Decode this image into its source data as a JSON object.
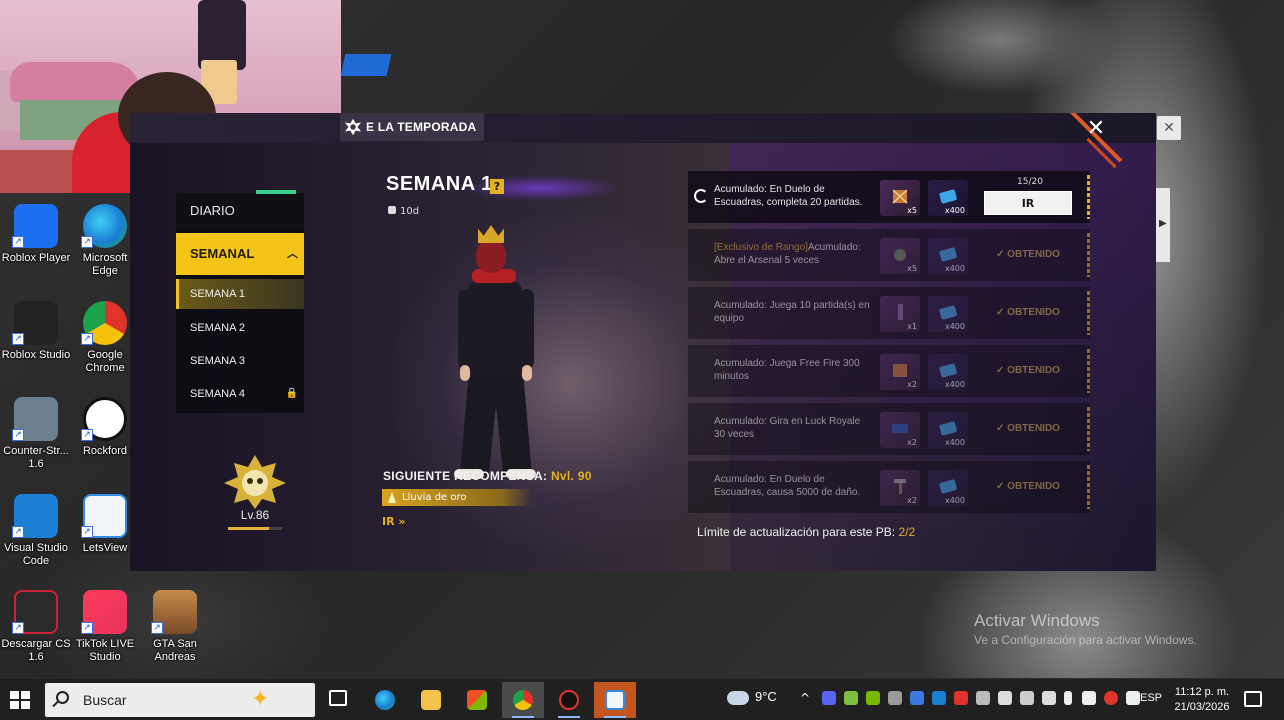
{
  "webcam": {
    "label": "webcam-feed"
  },
  "game": {
    "tab_title": "E LA TEMPORADA",
    "menu": {
      "daily": "DIARIO",
      "weekly": "SEMANAL",
      "weeks": [
        "SEMANA 1",
        "SEMANA 2",
        "SEMANA 3",
        "SEMANA 4"
      ]
    },
    "rank": {
      "level": "Lv.86",
      "progress": 0.75
    },
    "week_title": "SEMANA 1",
    "help_symbol": "?",
    "timer": "10d",
    "next_reward": {
      "label": "SIGUIENTE RECOMPENSA:",
      "level": "Nvl. 90",
      "item": "Lluvia de oro",
      "go": "IR »"
    },
    "missions": [
      {
        "prefix": "",
        "desc": "Acumulado: En Duelo de Escuadras, completa 20 partidas.",
        "qty1": "x5",
        "qty2": "x400",
        "progress": "15/20",
        "action": "IR",
        "status": ""
      },
      {
        "prefix": "[Exclusivo de Rango]",
        "desc": "Acumulado: Abre el Arsenal 5 veces",
        "qty1": "x5",
        "qty2": "x400",
        "progress": "",
        "action": "",
        "status": "OBTENIDO"
      },
      {
        "prefix": "",
        "desc": "Acumulado: Juega 10 partida(s) en equipo",
        "qty1": "x1",
        "qty2": "x400",
        "progress": "",
        "action": "",
        "status": "OBTENIDO"
      },
      {
        "prefix": "",
        "desc": "Acumulado: Juega Free Fire 300 minutos",
        "qty1": "x2",
        "qty2": "x400",
        "progress": "",
        "action": "",
        "status": "OBTENIDO"
      },
      {
        "prefix": "",
        "desc": "Acumulado: Gira en Luck Royale 30 veces",
        "qty1": "x2",
        "qty2": "x400",
        "progress": "",
        "action": "",
        "status": "OBTENIDO"
      },
      {
        "prefix": "",
        "desc": "Acumulado: En Duelo de Escuadras, causa 5000 de daño.",
        "qty1": "x2",
        "qty2": "x400",
        "progress": "",
        "action": "",
        "status": "OBTENIDO"
      }
    ],
    "limit_label": "Límite de actualización para este PB:",
    "limit_value": "2/2"
  },
  "desktop": {
    "icons": [
      {
        "label": "Roblox Player",
        "color": "#1d6ff2"
      },
      {
        "label": "Microsoft Edge",
        "color": "#1aa36d"
      },
      {
        "label": "Roblox Studio",
        "color": "#222222"
      },
      {
        "label": "Google Chrome",
        "color": "#e0332c"
      },
      {
        "label": "Counter-Str... 1.6",
        "color": "#6b7f8f"
      },
      {
        "label": "Rockford",
        "color": "#ffffff"
      },
      {
        "label": "Visual Studio Code",
        "color": "#1b7fd4"
      },
      {
        "label": "LetsView",
        "color": "#f2f6fb"
      },
      {
        "label": "Descargar CS 1.6",
        "color": "#2a2a2a"
      },
      {
        "label": "TikTok LIVE Studio",
        "color": "#e8335a"
      },
      {
        "label": "GTA San Andreas",
        "color": "#c68a4a"
      }
    ],
    "watermark": {
      "title": "Activar Windows",
      "subtitle": "Ve a Configuración para activar Windows."
    }
  },
  "taskbar": {
    "search_placeholder": "Buscar",
    "weather_temp": "9°C",
    "language": "ESP",
    "time": "11:12 p. m.",
    "date": "21/03/2026"
  }
}
